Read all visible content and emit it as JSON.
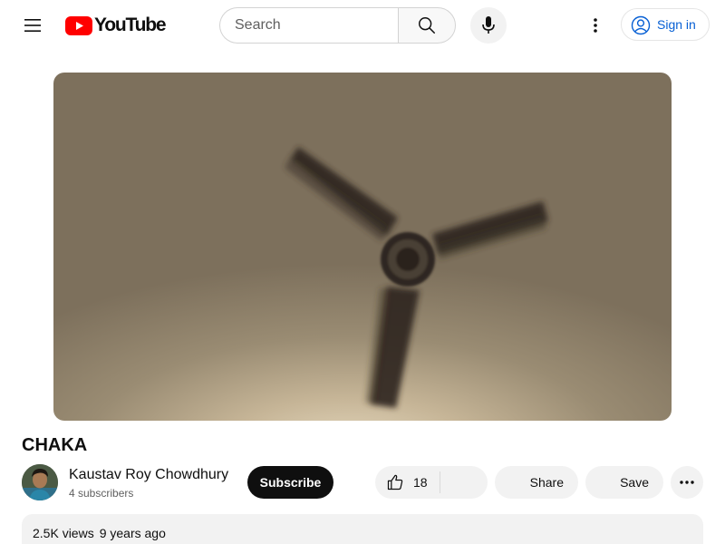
{
  "header": {
    "menu_icon": "hamburger-menu-icon",
    "logo_text": "YouTube",
    "brand_color": "#ff0000",
    "search": {
      "placeholder": "Search",
      "value": ""
    },
    "search_icon": "search-icon",
    "mic_icon": "microphone-icon",
    "more_icon": "vertical-dots-icon",
    "signin_label": "Sign in",
    "signin_icon": "account-circle-icon",
    "link_color": "#065fd4"
  },
  "video": {
    "title": "CHAKA",
    "channel": {
      "name": "Kaustav Roy Chowdhury",
      "subscribers": "4 subscribers"
    },
    "subscribe_label": "Subscribe",
    "likes": "18",
    "like_icon": "thumbs-up-icon",
    "dislike_icon": "thumbs-down-icon",
    "share_label": "Share",
    "share_icon": "share-arrow-icon",
    "save_label": "Save",
    "save_icon": "playlist-add-icon",
    "more_actions_icon": "horizontal-dots-icon",
    "views": "2.5K views",
    "published": "9 years ago"
  }
}
